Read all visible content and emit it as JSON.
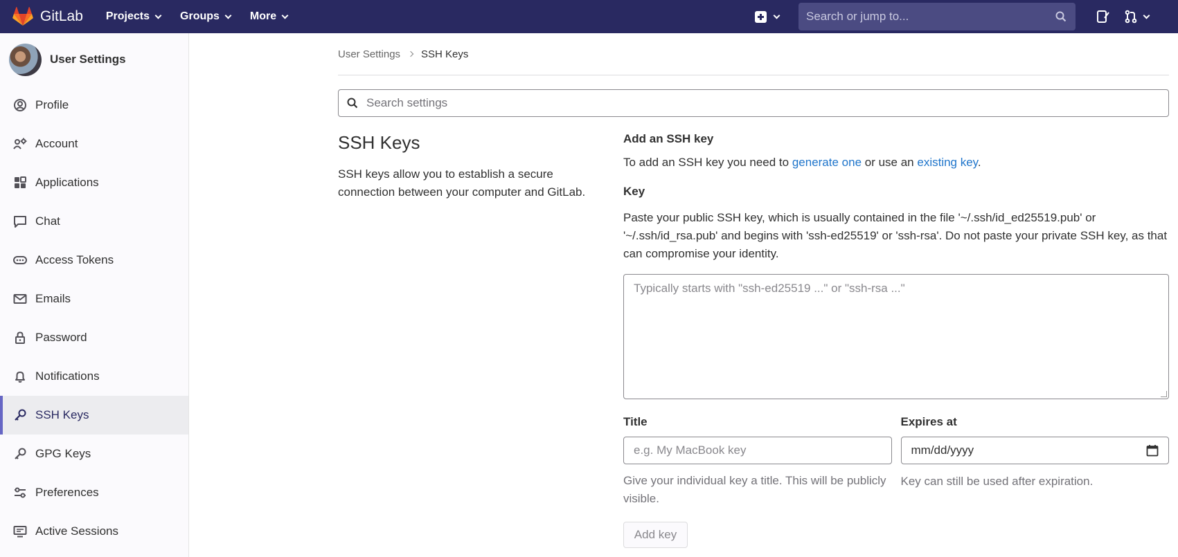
{
  "navbar": {
    "logo_text": "GitLab",
    "menu": [
      {
        "label": "Projects"
      },
      {
        "label": "Groups"
      },
      {
        "label": "More"
      }
    ],
    "search_placeholder": "Search or jump to..."
  },
  "sidebar": {
    "title": "User Settings",
    "items": [
      {
        "label": "Profile",
        "icon": "profile-icon"
      },
      {
        "label": "Account",
        "icon": "account-icon"
      },
      {
        "label": "Applications",
        "icon": "applications-icon"
      },
      {
        "label": "Chat",
        "icon": "chat-icon"
      },
      {
        "label": "Access Tokens",
        "icon": "access-tokens-icon"
      },
      {
        "label": "Emails",
        "icon": "email-icon"
      },
      {
        "label": "Password",
        "icon": "lock-icon"
      },
      {
        "label": "Notifications",
        "icon": "bell-icon"
      },
      {
        "label": "SSH Keys",
        "icon": "key-icon",
        "active": true
      },
      {
        "label": "GPG Keys",
        "icon": "key-icon"
      },
      {
        "label": "Preferences",
        "icon": "preferences-icon"
      },
      {
        "label": "Active Sessions",
        "icon": "monitor-icon"
      }
    ]
  },
  "breadcrumb": {
    "parent": "User Settings",
    "current": "SSH Keys"
  },
  "settings_search": {
    "placeholder": "Search settings"
  },
  "section": {
    "title": "SSH Keys",
    "description": "SSH keys allow you to establish a secure connection between your computer and GitLab."
  },
  "form": {
    "add_heading": "Add an SSH key",
    "add_text_prefix": "To add an SSH key you need to ",
    "link_generate": "generate one",
    "add_text_mid": " or use an ",
    "link_existing": "existing key",
    "add_text_suffix": ".",
    "key_label": "Key",
    "key_help": "Paste your public SSH key, which is usually contained in the file '~/.ssh/id_ed25519.pub' or '~/.ssh/id_rsa.pub' and begins with 'ssh-ed25519' or 'ssh-rsa'. Do not paste your private SSH key, as that can compromise your identity.",
    "key_placeholder": "Typically starts with \"ssh-ed25519 ...\" or \"ssh-rsa ...\"",
    "title_label": "Title",
    "title_placeholder": "e.g. My MacBook key",
    "title_help": "Give your individual key a title. This will be publicly visible.",
    "expires_label": "Expires at",
    "expires_value": "mm/dd/yyyy",
    "expires_help": "Key can still be used after expiration.",
    "submit_label": "Add key"
  },
  "colors": {
    "navbar_bg": "#292961",
    "link": "#1f75cb",
    "active_indicator": "#6666c4"
  }
}
